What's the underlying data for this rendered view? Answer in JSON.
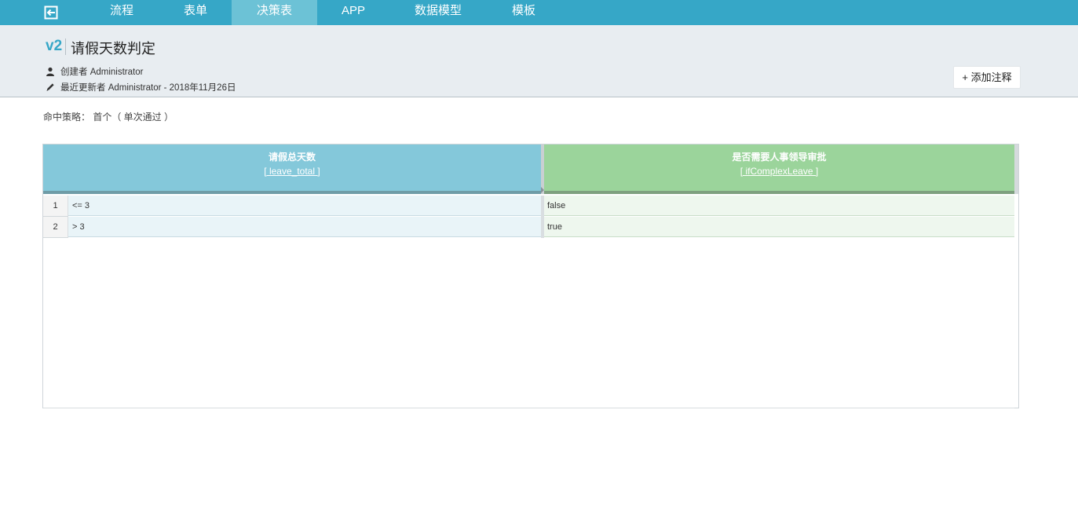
{
  "nav": {
    "tabs": [
      {
        "label": "流程"
      },
      {
        "label": "表单"
      },
      {
        "label": "决策表",
        "active": true
      },
      {
        "label": "APP"
      },
      {
        "label": "数据模型"
      },
      {
        "label": "模板"
      }
    ]
  },
  "header": {
    "version": "v2",
    "title": "请假天数判定",
    "created_by": "创建者 Administrator",
    "last_updated": "最近更新者 Administrator - 2018年11月26日",
    "add_note_label": "+ 添加注释"
  },
  "hit_policy": "命中策略： 首个（ 单次通过 ）",
  "decision_table": {
    "input_column": {
      "name": "请假总天数",
      "variable": "leave_total"
    },
    "output_column": {
      "name": "是否需要人事领导审批",
      "variable": "ifComplexLeave"
    },
    "rows": [
      {
        "num": "1",
        "input": "<= 3",
        "output": "false"
      },
      {
        "num": "2",
        "input": "> 3",
        "output": "true"
      }
    ]
  },
  "colors": {
    "nav_bg": "#36a7c7",
    "nav_active": "#6cc2d6",
    "input_header": "#84c8da",
    "output_header": "#9bd49b"
  }
}
